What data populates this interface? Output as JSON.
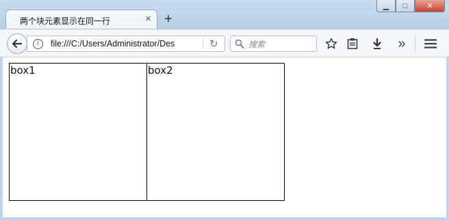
{
  "tab": {
    "title": "两个块元素显示在同一行",
    "close_glyph": "×"
  },
  "new_tab_glyph": "+",
  "window_controls": {
    "minimize": "▁",
    "maximize": "□",
    "close": "✕"
  },
  "navbar": {
    "back_glyph": "🡐",
    "url": "file:///C:/Users/Administrator/Des",
    "reload_glyph": "↻",
    "search_placeholder": "搜索",
    "search_icon_glyph": "⚲",
    "bookmark_glyph": "☆",
    "library_glyph": "▤",
    "download_glyph": "⬇",
    "overflow_glyph": "»",
    "menu_glyph": "☰"
  },
  "page": {
    "box1_label": "box1",
    "box2_label": "box2"
  },
  "colors": {
    "chrome": "#bcd3ea",
    "toolbar": "#f4f7fa",
    "close_button": "#c7432f",
    "box_border": "#000000"
  }
}
